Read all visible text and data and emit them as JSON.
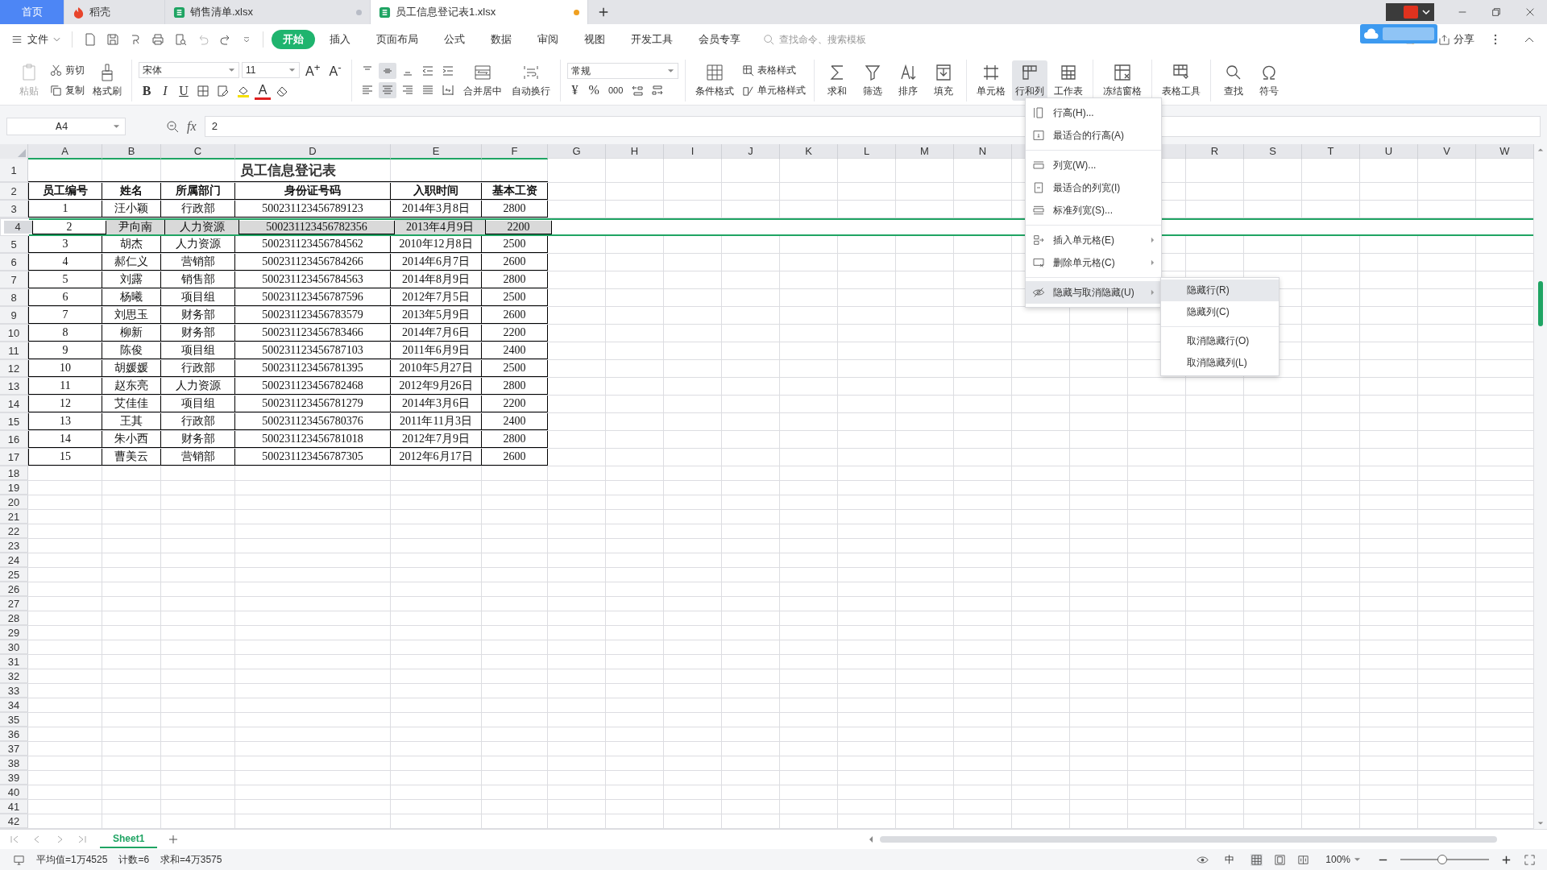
{
  "title_bar": {
    "tabs": [
      {
        "label": "首页",
        "kind": "home",
        "selected": false
      },
      {
        "label": "稻壳",
        "kind": "docer",
        "selected": false
      },
      {
        "label": "销售清单.xlsx",
        "kind": "sheet",
        "selected": false,
        "modified": false
      },
      {
        "label": "员工信息登记表1.xlsx",
        "kind": "sheet",
        "selected": true,
        "modified": true
      }
    ]
  },
  "menu_bar": {
    "file": "文件",
    "tabs": [
      {
        "label": "开始",
        "selected": true
      },
      {
        "label": "插入",
        "selected": false
      },
      {
        "label": "页面布局",
        "selected": false
      },
      {
        "label": "公式",
        "selected": false
      },
      {
        "label": "数据",
        "selected": false
      },
      {
        "label": "审阅",
        "selected": false
      },
      {
        "label": "视图",
        "selected": false
      },
      {
        "label": "开发工具",
        "selected": false
      },
      {
        "label": "会员专享",
        "selected": false
      }
    ],
    "search": {
      "placeholder": "查找命令、搜索模板"
    },
    "share": "分享"
  },
  "ribbon": {
    "paste": {
      "label": "粘贴",
      "disabled": true
    },
    "cut": "剪切",
    "copy": "复制",
    "format_painter": "格式刷",
    "font_name": "宋体",
    "font_size": "11",
    "grow_font": "A$^{+}$",
    "shrink_font": "A$^{-}$",
    "bold": "B",
    "italic": "I",
    "underline": "U",
    "font_color": "A",
    "vertical_align_buttons": [
      {
        "selected": false
      },
      {
        "selected": true
      },
      {
        "selected": false
      }
    ],
    "horizontal_align_buttons": [
      {
        "selected": false
      },
      {
        "selected": true
      },
      {
        "selected": false
      }
    ],
    "merge": "合并居中",
    "wrap": "自动换行",
    "number_format": "常规",
    "currency": "¥",
    "percent": "%",
    "thousands": "000",
    "conditional_format": "条件格式",
    "table_style": "表格样式",
    "cell_style": "单元格样式",
    "tool_groups": [
      [
        {
          "label": "求和",
          "selected": false
        },
        {
          "label": "筛选",
          "selected": false
        },
        {
          "label": "排序",
          "selected": false
        },
        {
          "label": "填充",
          "selected": false
        }
      ],
      [
        {
          "label": "单元格",
          "selected": false
        },
        {
          "label": "行和列",
          "selected": true
        },
        {
          "label": "工作表",
          "selected": false
        }
      ],
      [
        {
          "label": "冻结窗格",
          "selected": false
        }
      ],
      [
        {
          "label": "表格工具",
          "selected": false
        }
      ],
      [
        {
          "label": "查找",
          "selected": false
        },
        {
          "label": "符号",
          "selected": false
        }
      ]
    ]
  },
  "formula_bar": {
    "cell_reference": "A4",
    "fx": "fx",
    "value": "2"
  },
  "sheet": {
    "columns": [
      "A",
      "B",
      "C",
      "D",
      "E",
      "F",
      "G",
      "H",
      "I",
      "J",
      "K",
      "L",
      "M",
      "N",
      "R",
      "S",
      "T",
      "U",
      "V",
      "W"
    ],
    "rows": [
      {
        "label": "1",
        "kind": "title",
        "selected": false,
        "cells": [
          "员工信息登记表"
        ]
      },
      {
        "label": "2",
        "kind": "header",
        "selected": false,
        "cells": [
          "员工编号",
          "姓名",
          "所属部门",
          "身份证号码",
          "入职时间",
          "基本工资"
        ]
      },
      {
        "label": "3",
        "kind": "data",
        "selected": false,
        "cells": [
          "1",
          "汪小颖",
          "行政部",
          "500231123456789123",
          "2014年3月8日",
          "2800"
        ]
      },
      {
        "label": "4",
        "kind": "data",
        "selected": true,
        "cells": [
          "2",
          "尹向南",
          "人力资源",
          "500231123456782356",
          "2013年4月9日",
          "2200"
        ]
      },
      {
        "label": "5",
        "kind": "data",
        "selected": false,
        "cells": [
          "3",
          "胡杰",
          "人力资源",
          "500231123456784562",
          "2010年12月8日",
          "2500"
        ]
      },
      {
        "label": "6",
        "kind": "data",
        "selected": false,
        "cells": [
          "4",
          "郝仁义",
          "营销部",
          "500231123456784266",
          "2014年6月7日",
          "2600"
        ]
      },
      {
        "label": "7",
        "kind": "data",
        "selected": false,
        "cells": [
          "5",
          "刘露",
          "销售部",
          "500231123456784563",
          "2014年8月9日",
          "2800"
        ]
      },
      {
        "label": "8",
        "kind": "data",
        "selected": false,
        "cells": [
          "6",
          "杨曦",
          "项目组",
          "500231123456787596",
          "2012年7月5日",
          "2500"
        ]
      },
      {
        "label": "9",
        "kind": "data",
        "selected": false,
        "cells": [
          "7",
          "刘思玉",
          "财务部",
          "500231123456783579",
          "2013年5月9日",
          "2600"
        ]
      },
      {
        "label": "10",
        "kind": "data",
        "selected": false,
        "cells": [
          "8",
          "柳新",
          "财务部",
          "500231123456783466",
          "2014年7月6日",
          "2200"
        ]
      },
      {
        "label": "11",
        "kind": "data",
        "selected": false,
        "cells": [
          "9",
          "陈俊",
          "项目组",
          "500231123456787103",
          "2011年6月9日",
          "2400"
        ]
      },
      {
        "label": "12",
        "kind": "data",
        "selected": false,
        "cells": [
          "10",
          "胡媛媛",
          "行政部",
          "500231123456781395",
          "2010年5月27日",
          "2500"
        ]
      },
      {
        "label": "13",
        "kind": "data",
        "selected": false,
        "cells": [
          "11",
          "赵东亮",
          "人力资源",
          "500231123456782468",
          "2012年9月26日",
          "2800"
        ]
      },
      {
        "label": "14",
        "kind": "data",
        "selected": false,
        "cells": [
          "12",
          "艾佳佳",
          "项目组",
          "500231123456781279",
          "2014年3月6日",
          "2200"
        ]
      },
      {
        "label": "15",
        "kind": "data",
        "selected": false,
        "cells": [
          "13",
          "王其",
          "行政部",
          "500231123456780376",
          "2011年11月3日",
          "2400"
        ]
      },
      {
        "label": "16",
        "kind": "data",
        "selected": false,
        "cells": [
          "14",
          "朱小西",
          "财务部",
          "500231123456781018",
          "2012年7月9日",
          "2800"
        ]
      },
      {
        "label": "17",
        "kind": "data",
        "selected": false,
        "cells": [
          "15",
          "曹美云",
          "营销部",
          "500231123456787305",
          "2012年6月17日",
          "2600"
        ]
      },
      {
        "label": "18",
        "kind": "empty",
        "selected": false
      },
      {
        "label": "19",
        "kind": "empty",
        "selected": false
      },
      {
        "label": "20",
        "kind": "empty",
        "selected": false
      },
      {
        "label": "21",
        "kind": "empty",
        "selected": false
      },
      {
        "label": "22",
        "kind": "empty",
        "selected": false
      },
      {
        "label": "23",
        "kind": "empty",
        "selected": false
      },
      {
        "label": "24",
        "kind": "empty",
        "selected": false
      },
      {
        "label": "25",
        "kind": "empty",
        "selected": false
      },
      {
        "label": "26",
        "kind": "empty",
        "selected": false
      },
      {
        "label": "27",
        "kind": "empty",
        "selected": false
      },
      {
        "label": "28",
        "kind": "empty",
        "selected": false
      },
      {
        "label": "29",
        "kind": "empty",
        "selected": false
      },
      {
        "label": "30",
        "kind": "empty",
        "selected": false
      },
      {
        "label": "31",
        "kind": "empty",
        "selected": false
      },
      {
        "label": "32",
        "kind": "empty",
        "selected": false
      },
      {
        "label": "33",
        "kind": "empty",
        "selected": false
      },
      {
        "label": "34",
        "kind": "empty",
        "selected": false
      },
      {
        "label": "35",
        "kind": "empty",
        "selected": false
      },
      {
        "label": "36",
        "kind": "empty",
        "selected": false
      },
      {
        "label": "37",
        "kind": "empty",
        "selected": false
      },
      {
        "label": "38",
        "kind": "empty",
        "selected": false
      },
      {
        "label": "39",
        "kind": "empty",
        "selected": false
      },
      {
        "label": "40",
        "kind": "empty",
        "selected": false
      },
      {
        "label": "41",
        "kind": "empty",
        "selected": false
      },
      {
        "label": "42",
        "kind": "empty",
        "selected": false
      }
    ],
    "sheet_tabs": [
      {
        "label": "Sheet1",
        "selected": true
      }
    ]
  },
  "context_menu": {
    "items": [
      {
        "kind": "item",
        "label": "行高(H)...",
        "selected": false,
        "submenu": false
      },
      {
        "kind": "item",
        "label": "最适合的行高(A)",
        "selected": false,
        "submenu": false
      },
      {
        "kind": "separator"
      },
      {
        "kind": "item",
        "label": "列宽(W)...",
        "selected": false,
        "submenu": false
      },
      {
        "kind": "item",
        "label": "最适合的列宽(I)",
        "selected": false,
        "submenu": false
      },
      {
        "kind": "item",
        "label": "标准列宽(S)...",
        "selected": false,
        "submenu": false
      },
      {
        "kind": "separator"
      },
      {
        "kind": "item",
        "label": "插入单元格(E)",
        "selected": false,
        "submenu": true
      },
      {
        "kind": "item",
        "label": "删除单元格(C)",
        "selected": false,
        "submenu": true
      },
      {
        "kind": "separator"
      },
      {
        "kind": "item",
        "label": "隐藏与取消隐藏(U)",
        "selected": true,
        "submenu": true
      }
    ],
    "submenu": [
      {
        "kind": "item",
        "label": "隐藏行(R)",
        "selected": true
      },
      {
        "kind": "item",
        "label": "隐藏列(C)",
        "selected": false
      },
      {
        "kind": "separator"
      },
      {
        "kind": "item",
        "label": "取消隐藏行(O)",
        "selected": false
      },
      {
        "kind": "item",
        "label": "取消隐藏列(L)",
        "selected": false
      }
    ]
  },
  "status_bar": {
    "stats": [
      "平均值=1万4525",
      "计数=6",
      "求和=4万3575"
    ],
    "input_mode": "中",
    "zoom": "100%",
    "zoom_level": {
      "level": 0.47
    }
  }
}
